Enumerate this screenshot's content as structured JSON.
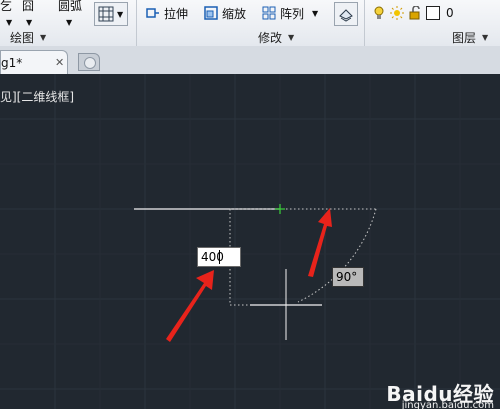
{
  "ribbon": {
    "row1": {
      "left_fragment_1": "乞",
      "left_fragment_2": "囧",
      "left_fragment_3": "圆弧"
    },
    "modify_tools": {
      "stretch_label": "拉伸",
      "scale_label": "缩放",
      "array_label": "阵列"
    },
    "layer": {
      "current_layer": "0"
    },
    "panel_titles": {
      "draw": "绘图",
      "modify": "修改",
      "layers": "图层"
    }
  },
  "tabs": {
    "drawing_tab_label": "g1*"
  },
  "canvas": {
    "view_label": "见][二维线框]",
    "dynamic_input": {
      "length_value": "400"
    },
    "angle_tooltip": "90°"
  },
  "watermark": {
    "brand": "Baidu经验",
    "url": "jingyan.baidu.com"
  },
  "colors": {
    "canvas_bg": "#212830",
    "annotation_arrow": "#e8231b",
    "ucs_green": "#3bd13b"
  }
}
